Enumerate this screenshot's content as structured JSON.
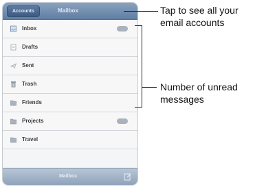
{
  "navbar": {
    "back_label": "Accounts",
    "title": "Mailbox"
  },
  "mailboxes": [
    {
      "label": "Inbox",
      "icon": "inbox-icon",
      "has_unread_badge": true
    },
    {
      "label": "Drafts",
      "icon": "drafts-icon",
      "has_unread_badge": false
    },
    {
      "label": "Sent",
      "icon": "sent-icon",
      "has_unread_badge": false
    },
    {
      "label": "Trash",
      "icon": "trash-icon",
      "has_unread_badge": false
    },
    {
      "label": "Friends",
      "icon": "folder-icon",
      "has_unread_badge": false
    },
    {
      "label": "Projects",
      "icon": "folder-icon",
      "has_unread_badge": true
    },
    {
      "label": "Travel",
      "icon": "folder-icon",
      "has_unread_badge": false
    }
  ],
  "toolbar": {
    "label": "Mailbox",
    "compose_icon": "compose-icon"
  },
  "callouts": {
    "accounts": [
      "Tap to see all your",
      "email accounts"
    ],
    "unread": [
      "Number of unread",
      "messages"
    ]
  },
  "colors": {
    "navbar": "#6f8cb1",
    "toolbar": "#a3b4c9",
    "badge": "#aab2bd"
  }
}
